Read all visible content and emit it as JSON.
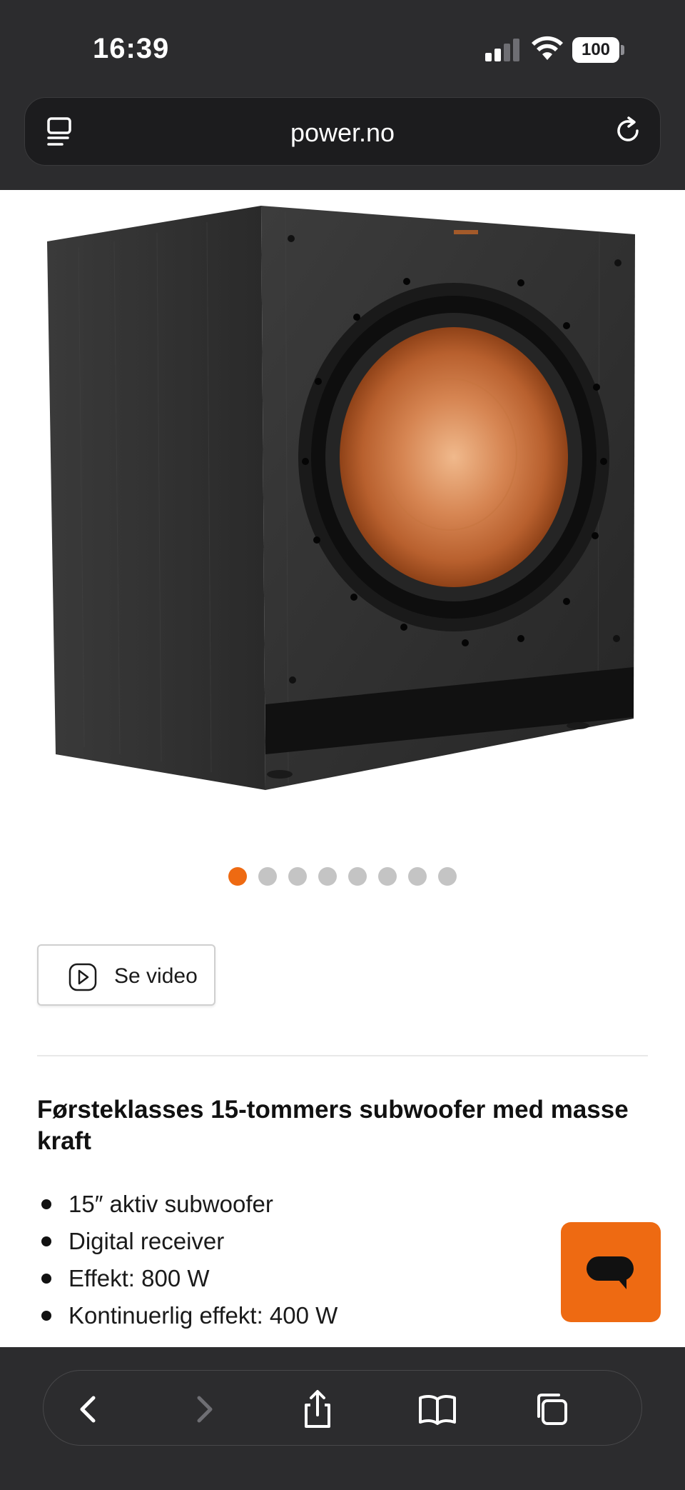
{
  "status_bar": {
    "time": "16:39",
    "battery": "100",
    "icons": [
      "signal-icon",
      "wifi-icon",
      "battery-icon"
    ]
  },
  "browser": {
    "url": "power.no",
    "icons": [
      "reader-icon",
      "reload-icon"
    ]
  },
  "product": {
    "image_alt": "Subwoofer with copper cone driver",
    "image_count": 8,
    "active_image_index": 0,
    "video_button_label": "Se video",
    "headline": "Førsteklasses 15-tommers subwoofer med masse kraft",
    "features": [
      "15″ aktiv subwoofer",
      "Digital receiver",
      "Effekt: 800 W",
      "Kontinuerlig effekt: 400 W"
    ]
  },
  "chat": {
    "icon": "chat-icon",
    "color": "#ee6a12"
  },
  "toolbar": {
    "icons": [
      "back-icon",
      "forward-icon",
      "share-icon",
      "bookmarks-icon",
      "tabs-icon"
    ]
  },
  "colors": {
    "accent": "#ee6a12",
    "chrome": "#2c2c2e"
  }
}
